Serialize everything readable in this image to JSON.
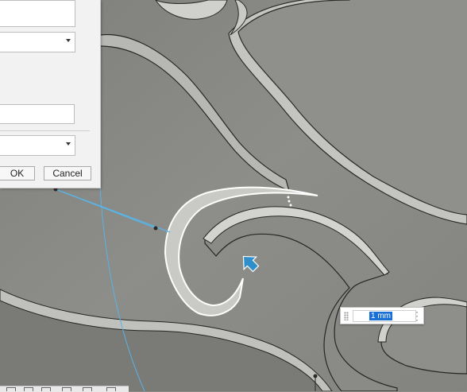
{
  "dialog": {
    "ok_label": "OK",
    "cancel_label": "Cancel"
  },
  "dimension_input": {
    "value": "1 mm"
  },
  "colors": {
    "model_surface": "#8c8c88",
    "selection_highlight": "#ffffff",
    "sketch_line": "#5ab4e6",
    "manipulator_arrow": "#2f8fcb",
    "selected_text": "#1a6fd6"
  },
  "icons": [
    "move-arrow-icon",
    "more-options-icon",
    "grip-icon"
  ]
}
